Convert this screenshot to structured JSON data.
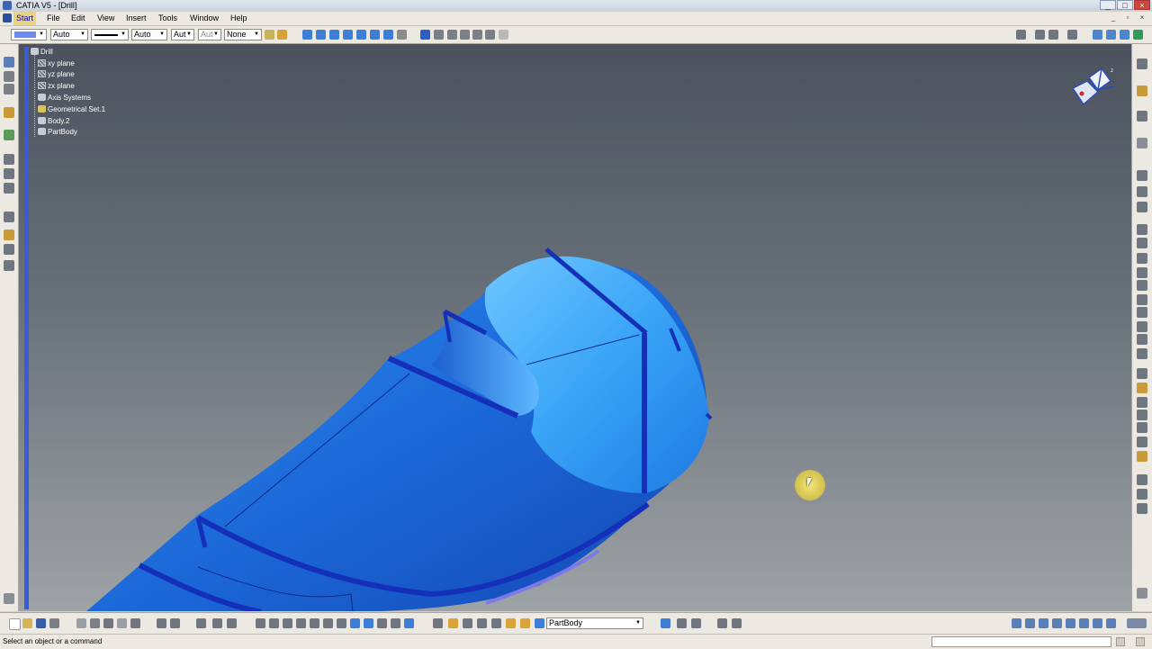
{
  "window": {
    "title": "CATIA V5 - [Drill]",
    "controls": [
      "_",
      "□",
      "×"
    ]
  },
  "menu": {
    "items": [
      "Start",
      "File",
      "Edit",
      "View",
      "Insert",
      "Tools",
      "Window",
      "Help"
    ]
  },
  "properties_toolbar": {
    "color_value": "",
    "transparency_value": "Auto",
    "line_thickness_value": "Auto",
    "line_type_value": "Aut",
    "point_symbol_value": "Aut",
    "layer_value": "None"
  },
  "spec_tree": {
    "root": "Drill",
    "nodes": [
      "xy plane",
      "yz plane",
      "zx plane",
      "Axis Systems",
      "Geometrical Set.1",
      "Body.2",
      "PartBody"
    ]
  },
  "bottom_toolbar": {
    "current_body": "PartBody"
  },
  "status": {
    "message": "Select an object or a command"
  },
  "colors": {
    "part_blue": "#1f7fe8",
    "edge_blue": "#1530b8",
    "tree_bar": "#3b5bd6",
    "background_top": "#4b525e",
    "background_bottom": "#9ea3a6"
  }
}
